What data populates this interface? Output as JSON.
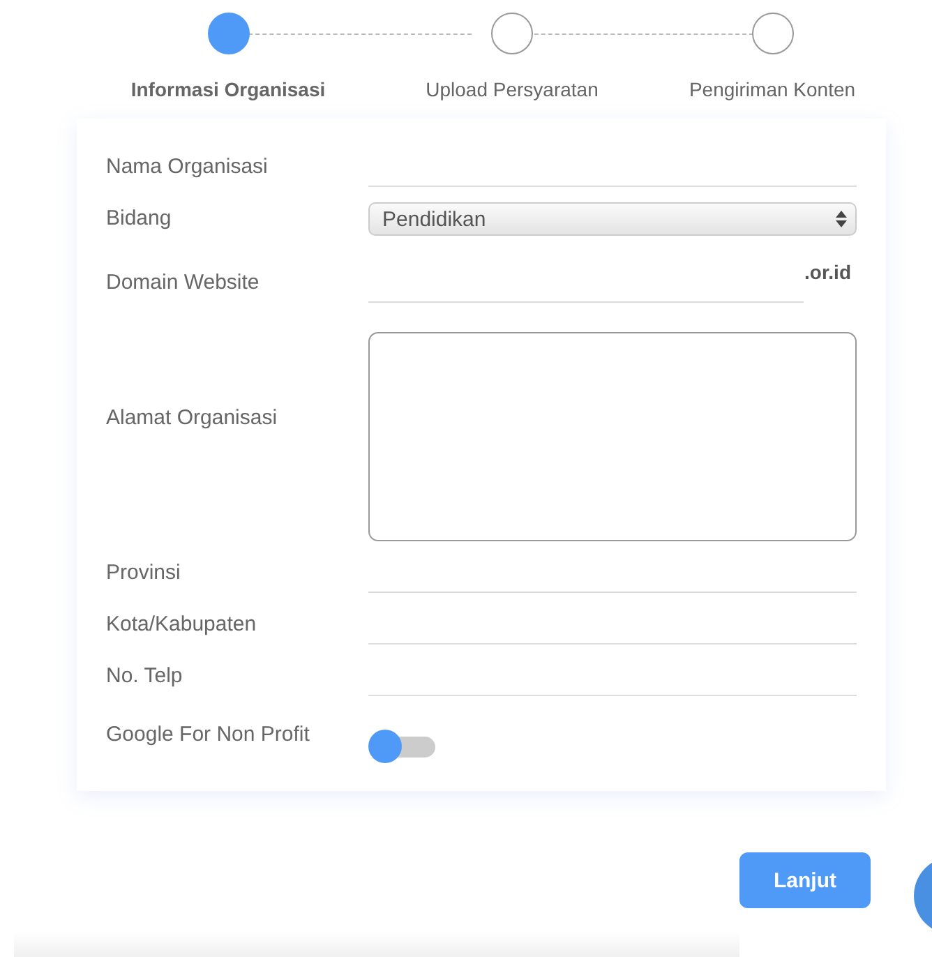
{
  "steps": [
    {
      "label": "Informasi Organisasi",
      "selected": true
    },
    {
      "label": "Upload Persyaratan",
      "selected": false
    },
    {
      "label": "Pengiriman Konten",
      "selected": false
    }
  ],
  "form": {
    "fields": [
      {
        "kind": "text",
        "label": "Nama Organisasi"
      },
      {
        "kind": "select",
        "label": "Bidang",
        "value": "Pendidikan"
      },
      {
        "kind": "suffix",
        "label": "Domain Website",
        "suffix": ".or.id"
      },
      {
        "kind": "textarea",
        "label": "Alamat Organisasi"
      },
      {
        "kind": "text",
        "label": "Provinsi"
      },
      {
        "kind": "text",
        "label": "Kota/Kabupaten"
      },
      {
        "kind": "text",
        "label": "No. Telp"
      },
      {
        "kind": "toggle",
        "label": "Google For Non Profit",
        "on": false
      }
    ]
  },
  "next_button": "Lanjut"
}
